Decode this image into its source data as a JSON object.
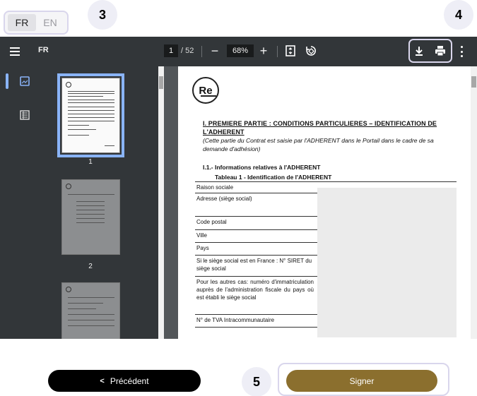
{
  "language": {
    "options": [
      "FR",
      "EN"
    ],
    "selected": "FR"
  },
  "steps": {
    "lang": "3",
    "toolbar": "4",
    "sign": "5"
  },
  "viewer": {
    "title": "FR",
    "page_current": "1",
    "page_total": "/ 52",
    "zoom": "68%",
    "icons": [
      "menu-icon",
      "zoom-out-icon",
      "zoom-in-icon",
      "fit-page-icon",
      "rotate-icon",
      "download-icon",
      "print-icon",
      "more-icon",
      "thumbnail-view-icon",
      "outline-view-icon"
    ],
    "thumbnails": [
      {
        "number": "1",
        "selected": true
      },
      {
        "number": "2",
        "selected": false
      },
      {
        "number": "",
        "selected": false
      }
    ]
  },
  "document": {
    "logo": "Re",
    "heading": "I. PREMIERE PARTIE : CONDITIONS PARTICULIERES – IDENTIFICATION DE L'ADHERENT",
    "subtext": "(Cette partie du Contrat est saisie par l'ADHERENT dans le Portail dans le cadre de sa demande d'adhésion)",
    "section_title": "I.1.- Informations relatives à l'ADHERENT",
    "table_title": "Tableau 1 - Identification de l'ADHERENT",
    "table_rows": [
      "Raison sociale",
      "Adresse (siège social)",
      "Code postal",
      "Ville",
      "Pays",
      "Si le siège social est en France : N° SIRET du siège social",
      "Pour les autres cas: numéro d'immatriculation auprès de l'administration fiscale du pays où est établi le siège social",
      "N° de TVA Intracommunautaire"
    ]
  },
  "footer": {
    "previous_label": "Précédent",
    "sign_label": "Signer"
  },
  "colors": {
    "accent": "#8b6f2e",
    "toolbar": "#323639",
    "viewer_bg": "#525659",
    "highlight": "#d9d6ec"
  }
}
